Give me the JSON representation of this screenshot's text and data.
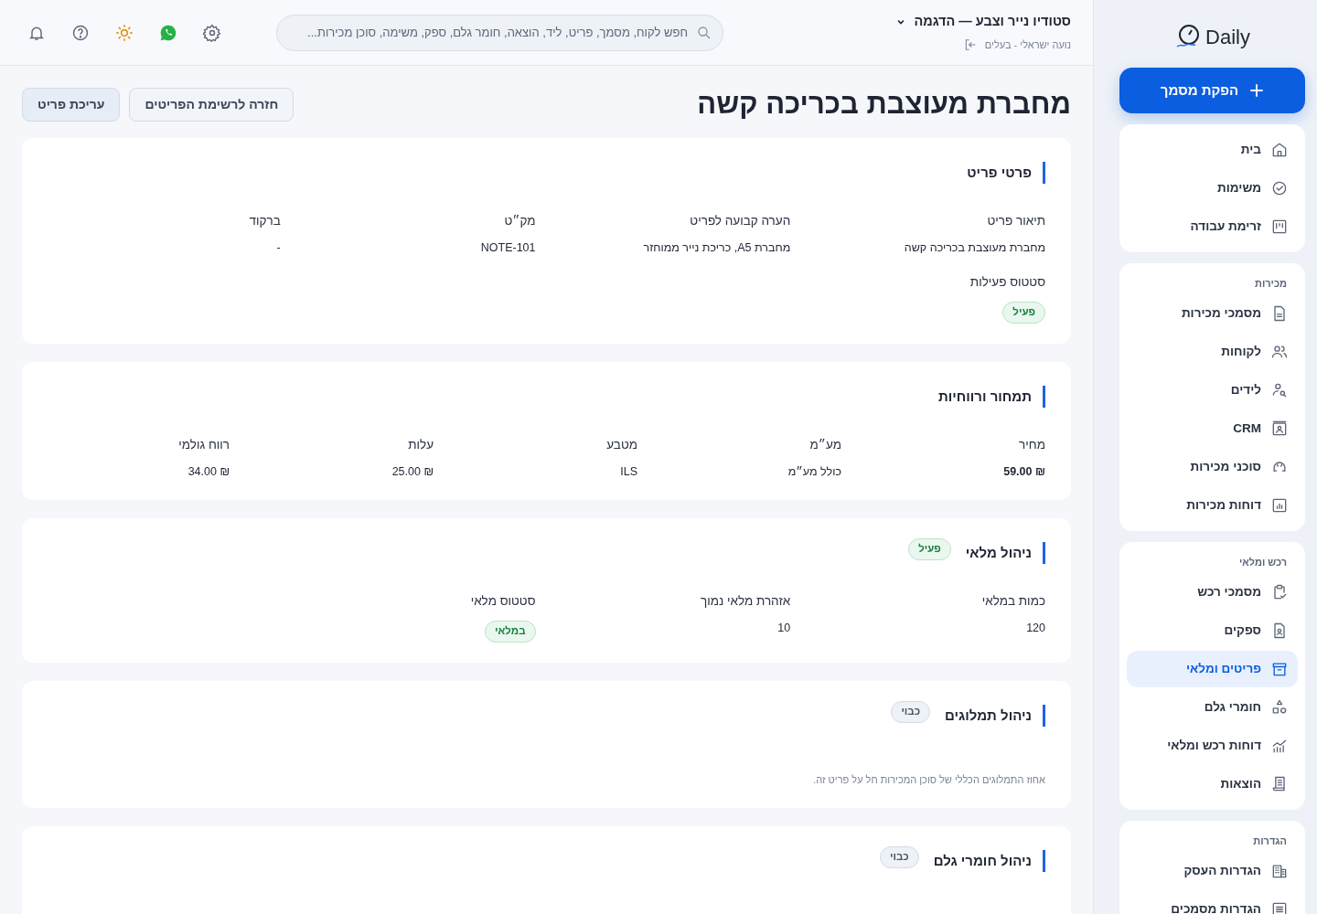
{
  "sidebar": {
    "logo": "Daily",
    "primary_button": "הפקת מסמך",
    "groups": [
      {
        "items": [
          {
            "label": "בית",
            "selected": false
          },
          {
            "label": "משימות",
            "selected": false
          },
          {
            "label": "זרימת עבודה",
            "selected": false
          }
        ]
      },
      {
        "heading": "מכירות",
        "items": [
          {
            "label": "מסמכי מכירות",
            "selected": false
          },
          {
            "label": "לקוחות",
            "selected": false
          },
          {
            "label": "לידים",
            "selected": false
          },
          {
            "label": "CRM",
            "selected": false
          },
          {
            "label": "סוכני מכירות",
            "selected": false
          },
          {
            "label": "דוחות מכירות",
            "selected": false
          }
        ]
      },
      {
        "heading": "רכש ומלאי",
        "items": [
          {
            "label": "מסמכי רכש",
            "selected": false
          },
          {
            "label": "ספקים",
            "selected": false
          },
          {
            "label": "פריטים ומלאי",
            "selected": true
          },
          {
            "label": "חומרי גלם",
            "selected": false
          },
          {
            "label": "דוחות רכש ומלאי",
            "selected": false
          },
          {
            "label": "הוצאות",
            "selected": false
          }
        ]
      },
      {
        "heading": "הגדרות",
        "items": [
          {
            "label": "הגדרות העסק",
            "selected": false
          },
          {
            "label": "הגדרות מסמכים",
            "selected": false
          }
        ]
      }
    ]
  },
  "header": {
    "company": "סטודיו נייר וצבע — הדגמה",
    "user": "נועה ישראלי - בעלים",
    "search": {
      "placeholder": "חפש לקוח, מסמך, פריט, ליד, הוצאה, חומר גלם, ספק, משימה, סוכן מכירות..."
    }
  },
  "page": {
    "title": "מחברת מעוצבת בכריכה קשה",
    "buttons": [
      "חזרה לרשימת הפריטים",
      "עריכת פריט"
    ]
  },
  "sections": [
    {
      "kind": "details",
      "title": "פרטי פריט",
      "fields": [
        {
          "label": "תיאור פריט",
          "value": "מחברת מעוצבת בכריכה קשה"
        },
        {
          "label": "הערה קבועה לפריט",
          "value": "מחברת A5, כריכת נייר ממוחזר"
        },
        {
          "label": "מק״ט",
          "value": "NOTE-101"
        },
        {
          "label": "ברקוד",
          "value": "-"
        },
        {
          "label": "סטטוס פעילות",
          "badge": {
            "text": "פעיל",
            "kind": "success"
          }
        }
      ]
    },
    {
      "kind": "pricing",
      "title": "תמחור ורווחיות",
      "fields": [
        {
          "label": "מחיר",
          "value": "₪ 59.00",
          "bold": true
        },
        {
          "label": "מע״מ",
          "value": "כולל מע״מ",
          "bold": false
        },
        {
          "label": "מטבע",
          "value": "ILS",
          "bold": false
        },
        {
          "label": "עלות",
          "value": "₪ 25.00",
          "bold": false
        },
        {
          "label": "רווח גולמי",
          "value": "₪ 34.00",
          "bold": false
        }
      ]
    },
    {
      "kind": "details",
      "title": "ניהול מלאי",
      "badge": {
        "text": "פעיל",
        "kind": "success"
      },
      "fields": [
        {
          "label": "כמות במלאי",
          "value": "120"
        },
        {
          "label": "אזהרת מלאי נמוך",
          "value": "10"
        },
        {
          "label": "סטטוס מלאי",
          "badge": {
            "text": "במלאי",
            "kind": "success"
          }
        }
      ]
    },
    {
      "title": "ניהול תמלוגים",
      "badge": {
        "text": "כבוי",
        "kind": "neutral"
      },
      "note": "אחוז התמלוגים הכללי של סוכן המכירות חל על פריט זה."
    },
    {
      "title": "ניהול חומרי גלם",
      "badge": {
        "text": "כבוי",
        "kind": "neutral"
      }
    }
  ]
}
